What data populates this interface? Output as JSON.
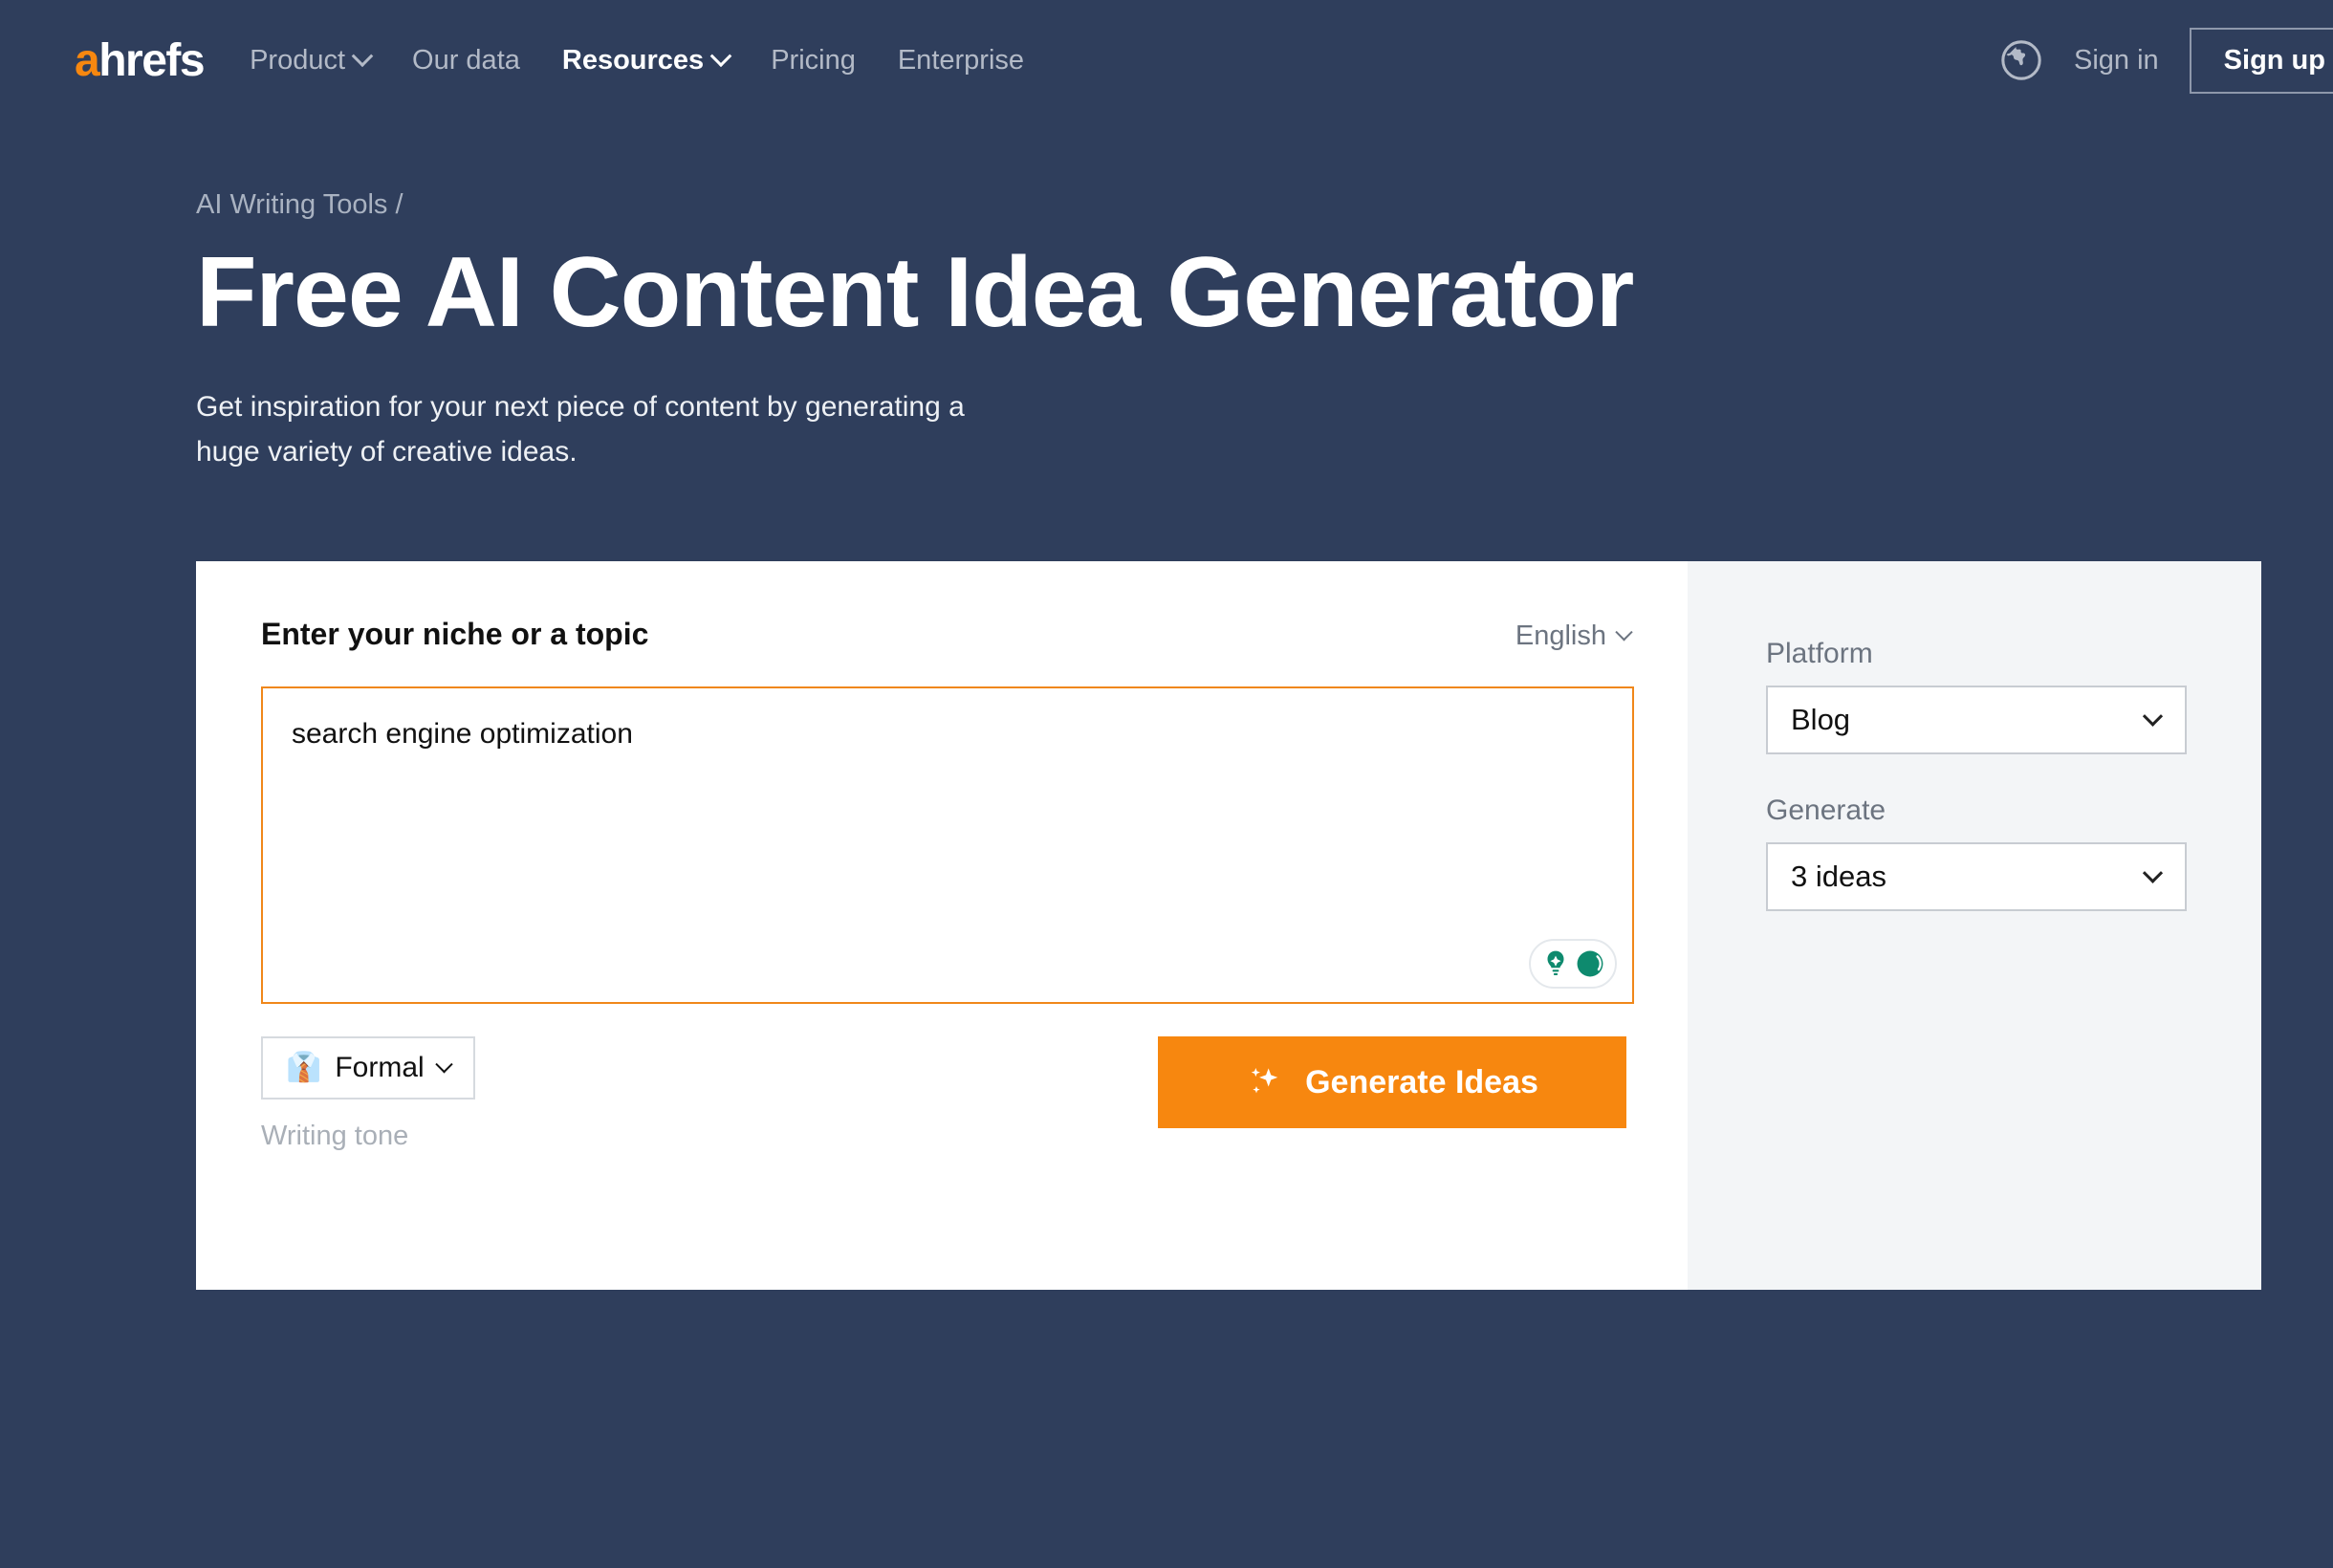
{
  "header": {
    "logo_a": "a",
    "logo_rest": "hrefs",
    "nav": [
      {
        "label": "Product",
        "has_caret": true,
        "active": false
      },
      {
        "label": "Our data",
        "has_caret": false,
        "active": false
      },
      {
        "label": "Resources",
        "has_caret": true,
        "active": true
      },
      {
        "label": "Pricing",
        "has_caret": false,
        "active": false
      },
      {
        "label": "Enterprise",
        "has_caret": false,
        "active": false
      }
    ],
    "globe_icon": "globe-icon",
    "signin_label": "Sign in",
    "signup_label": "Sign up"
  },
  "hero": {
    "breadcrumb": "AI Writing Tools /",
    "title": "Free AI Content Idea Generator",
    "subtitle": "Get inspiration for your next piece of content by generating a huge variety of creative ideas."
  },
  "tool": {
    "input_label": "Enter your niche or a topic",
    "language": "English",
    "topic_value": "search engine optimization",
    "topic_placeholder": "Enter your niche or a topic",
    "grammarly_icons": [
      "lightbulb-icon",
      "grammarly-circle-icon"
    ],
    "tone_emoji": "👔",
    "tone_value": "Formal",
    "tone_caption": "Writing tone",
    "generate_icon": "sparkles-icon",
    "generate_label": "Generate Ideas",
    "side": {
      "platform_label": "Platform",
      "platform_value": "Blog",
      "generate_label": "Generate",
      "generate_value": "3 ideas"
    }
  },
  "colors": {
    "page_bg": "#2f3e5c",
    "brand_orange": "#f7870f",
    "card_bg": "#ffffff",
    "side_panel_bg": "#f3f5f7",
    "muted_text": "#b3bac7",
    "grammarly_teal": "#0e8a6e"
  }
}
